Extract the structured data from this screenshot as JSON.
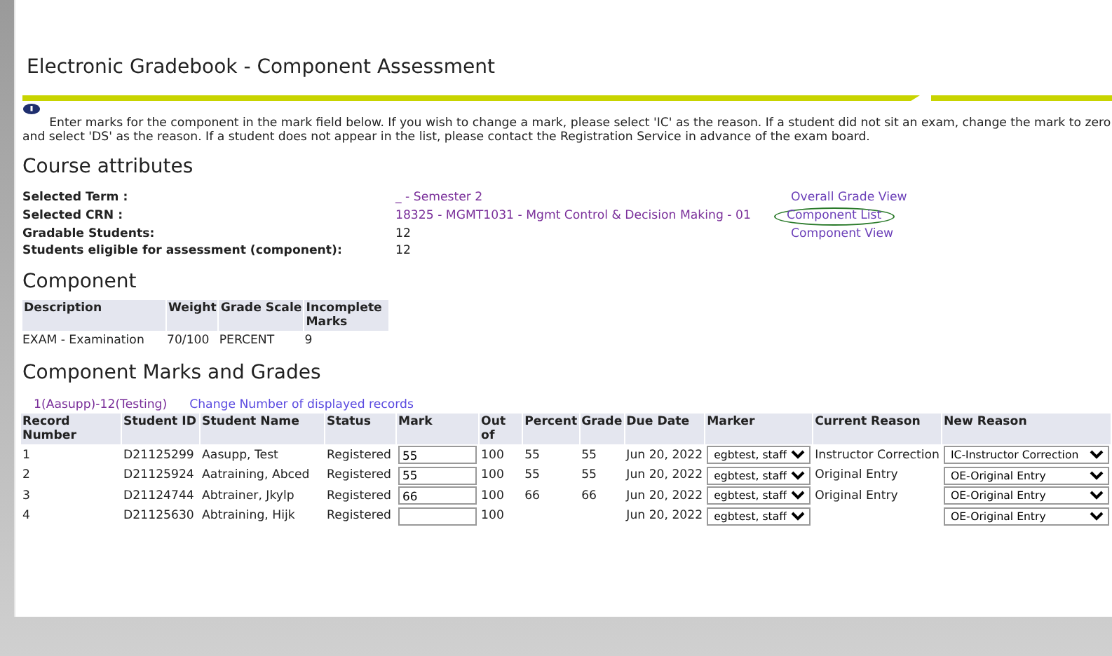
{
  "page_title": "Electronic Gradebook - Component Assessment",
  "instructions": "Enter marks for the component in the mark field below. If you wish to change a mark, please select 'IC' as the reason. If a student did not sit an exam, change the mark to zero and select 'DS' as the reason. If a student does not appear in the list, please contact the Registration Service in advance of the exam board.",
  "course_attributes": {
    "heading": "Course attributes",
    "rows": [
      {
        "label": "Selected Term :",
        "value": "_                         - Semester 2",
        "kind": "link",
        "link": "Overall Grade View",
        "circled": false
      },
      {
        "label": "Selected CRN :",
        "value": "18325 - MGMT1031 - Mgmt Control & Decision Making - 01",
        "kind": "link",
        "link": "Component List",
        "circled": true
      },
      {
        "label": "Gradable Students:",
        "value": "12",
        "kind": "text",
        "link": "Component View",
        "circled": false
      },
      {
        "label": "Students eligible for assessment (component):",
        "value": "12",
        "kind": "text"
      }
    ]
  },
  "component": {
    "heading": "Component",
    "columns": [
      "Description",
      "Weight",
      "Grade Scale",
      "Incomplete Marks"
    ],
    "row": [
      "EXAM - Examination",
      "70/100",
      "PERCENT",
      "9"
    ]
  },
  "marks": {
    "heading": "Component Marks and Grades",
    "range": "1(Aasupp)-12(Testing)",
    "change_link": "Change Number of displayed records",
    "columns": [
      "Record Number",
      "Student ID",
      "Student Name",
      "Status",
      "Mark",
      "Out of",
      "Percent",
      "Grade",
      "Due Date",
      "Marker",
      "Current Reason",
      "New Reason"
    ],
    "rows": [
      {
        "number": "1",
        "id": "D21125299",
        "name": "Aasupp, Test",
        "status": "Registered",
        "mark": "55",
        "out_of": "100",
        "percent": "55",
        "grade": "55",
        "due": "Jun 20, 2022",
        "marker": "egbtest, staff",
        "current_reason": "Instructor Correction",
        "new_reason": "IC-Instructor Correction"
      },
      {
        "number": "2",
        "id": "D21125924",
        "name": "Aatraining, Abced",
        "status": "Registered",
        "mark": "55",
        "out_of": "100",
        "percent": "55",
        "grade": "55",
        "due": "Jun 20, 2022",
        "marker": "egbtest, staff",
        "current_reason": "Original Entry",
        "new_reason": "OE-Original Entry"
      },
      {
        "number": "3",
        "id": "D21124744",
        "name": "Abtrainer, Jkylp",
        "status": "Registered",
        "mark": "66",
        "out_of": "100",
        "percent": "66",
        "grade": "66",
        "due": "Jun 20, 2022",
        "marker": "egbtest, staff",
        "current_reason": "Original Entry",
        "new_reason": "OE-Original Entry"
      },
      {
        "number": "4",
        "id": "D21125630",
        "name": "Abtraining, Hijk",
        "status": "Registered",
        "out_of": "100",
        "due": "Jun 20, 2022",
        "marker": "egbtest, staff",
        "new_reason": "OE-Original Entry"
      }
    ]
  }
}
